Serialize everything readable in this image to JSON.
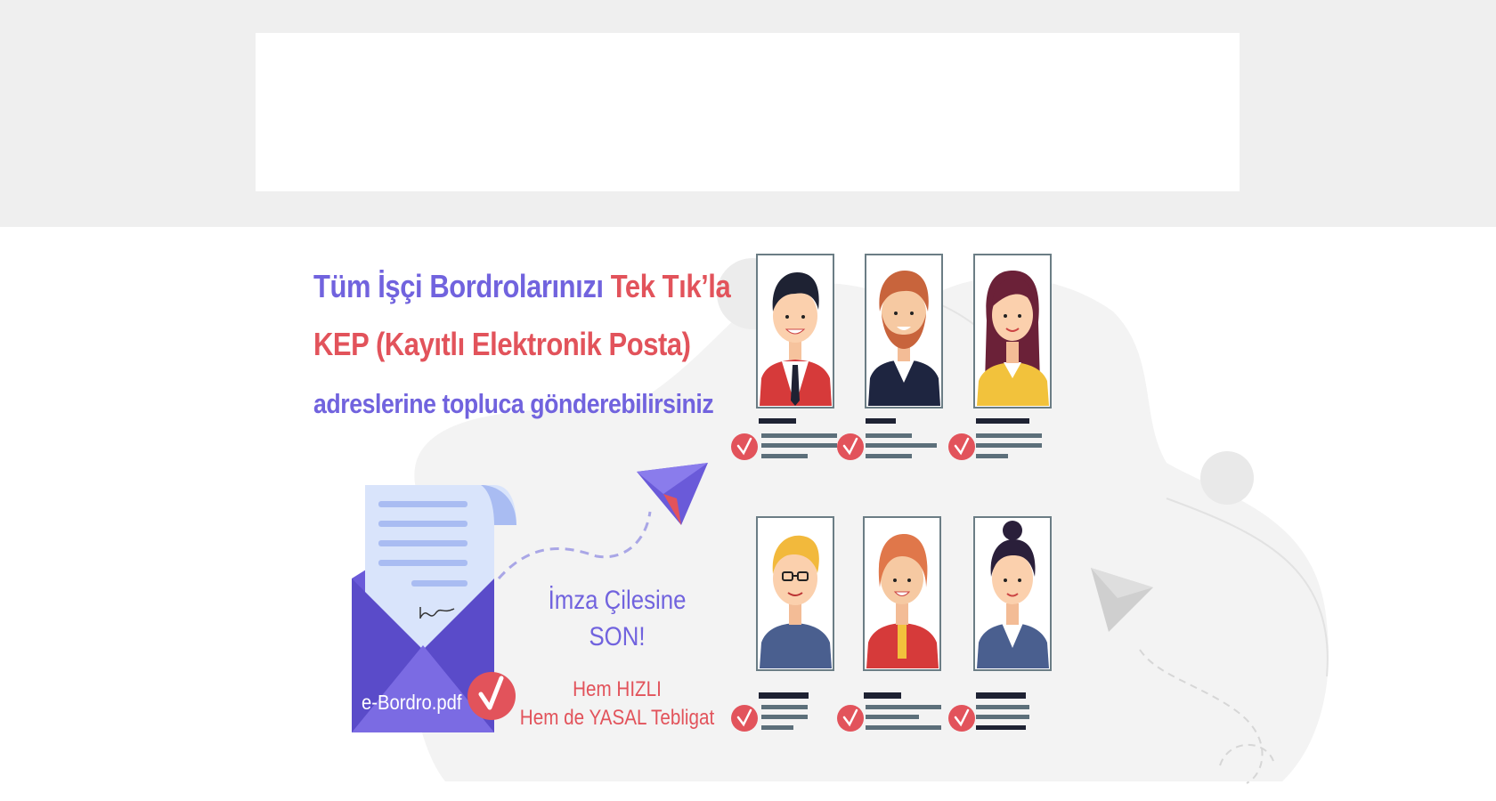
{
  "banner": {
    "headline_line1": {
      "part1": "Tüm İşçi Bordrolarınızı",
      "part2": "Tek Tık’la"
    },
    "headline_line2": "KEP (Kayıtlı Elektronik Posta)",
    "headline_line3": "adreslerine topluca gönderebilirsiniz",
    "slogan_line1": "İmza Çilesine",
    "slogan_line2": "SON!",
    "tagline_line1": "Hem HIZLI",
    "tagline_line2": "Hem de YASAL Tebligat",
    "file_label": "e-Bordro.pdf"
  },
  "colors": {
    "purple": "#7163de",
    "red": "#e2535b",
    "background_top": "#efefef",
    "blob": "#f3f3f3"
  },
  "icons": [
    "envelope-icon",
    "document-icon",
    "checkmark-icon",
    "paper-plane-icon",
    "avatar-icon"
  ]
}
